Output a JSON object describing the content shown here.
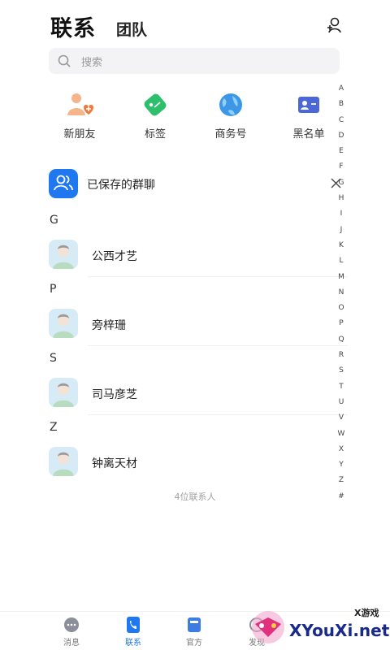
{
  "header": {
    "title": "联系",
    "tab_team": "团队"
  },
  "search": {
    "placeholder": "搜索"
  },
  "quick_actions": [
    {
      "label": "新朋友",
      "icon": "new-friend-icon"
    },
    {
      "label": "标签",
      "icon": "tag-icon"
    },
    {
      "label": "商务号",
      "icon": "globe-icon"
    },
    {
      "label": "黑名单",
      "icon": "blacklist-card-icon"
    }
  ],
  "saved_groups": {
    "label": "已保存的群聊"
  },
  "sections": [
    {
      "letter": "G",
      "contacts": [
        "公西才艺"
      ]
    },
    {
      "letter": "P",
      "contacts": [
        "旁梓珊"
      ]
    },
    {
      "letter": "S",
      "contacts": [
        "司马彦芝"
      ]
    },
    {
      "letter": "Z",
      "contacts": [
        "钟离天材"
      ]
    }
  ],
  "contact_count": "4位联系人",
  "index_letters": [
    "A",
    "B",
    "C",
    "D",
    "E",
    "F",
    "G",
    "H",
    "I",
    "J",
    "K",
    "L",
    "M",
    "N",
    "O",
    "P",
    "Q",
    "R",
    "S",
    "T",
    "U",
    "V",
    "W",
    "X",
    "Y",
    "Z",
    "#"
  ],
  "bottom_nav": [
    {
      "label": "消息",
      "active": false
    },
    {
      "label": "联系",
      "active": true
    },
    {
      "label": "官方",
      "active": false
    },
    {
      "label": "发现",
      "active": false
    }
  ],
  "watermark": {
    "text": "XYouXi.net",
    "small": "X游戏"
  },
  "colors": {
    "accent": "#1f78f0",
    "tag_green": "#2dbf6c",
    "new_friend_orange": "#f08a4b"
  }
}
